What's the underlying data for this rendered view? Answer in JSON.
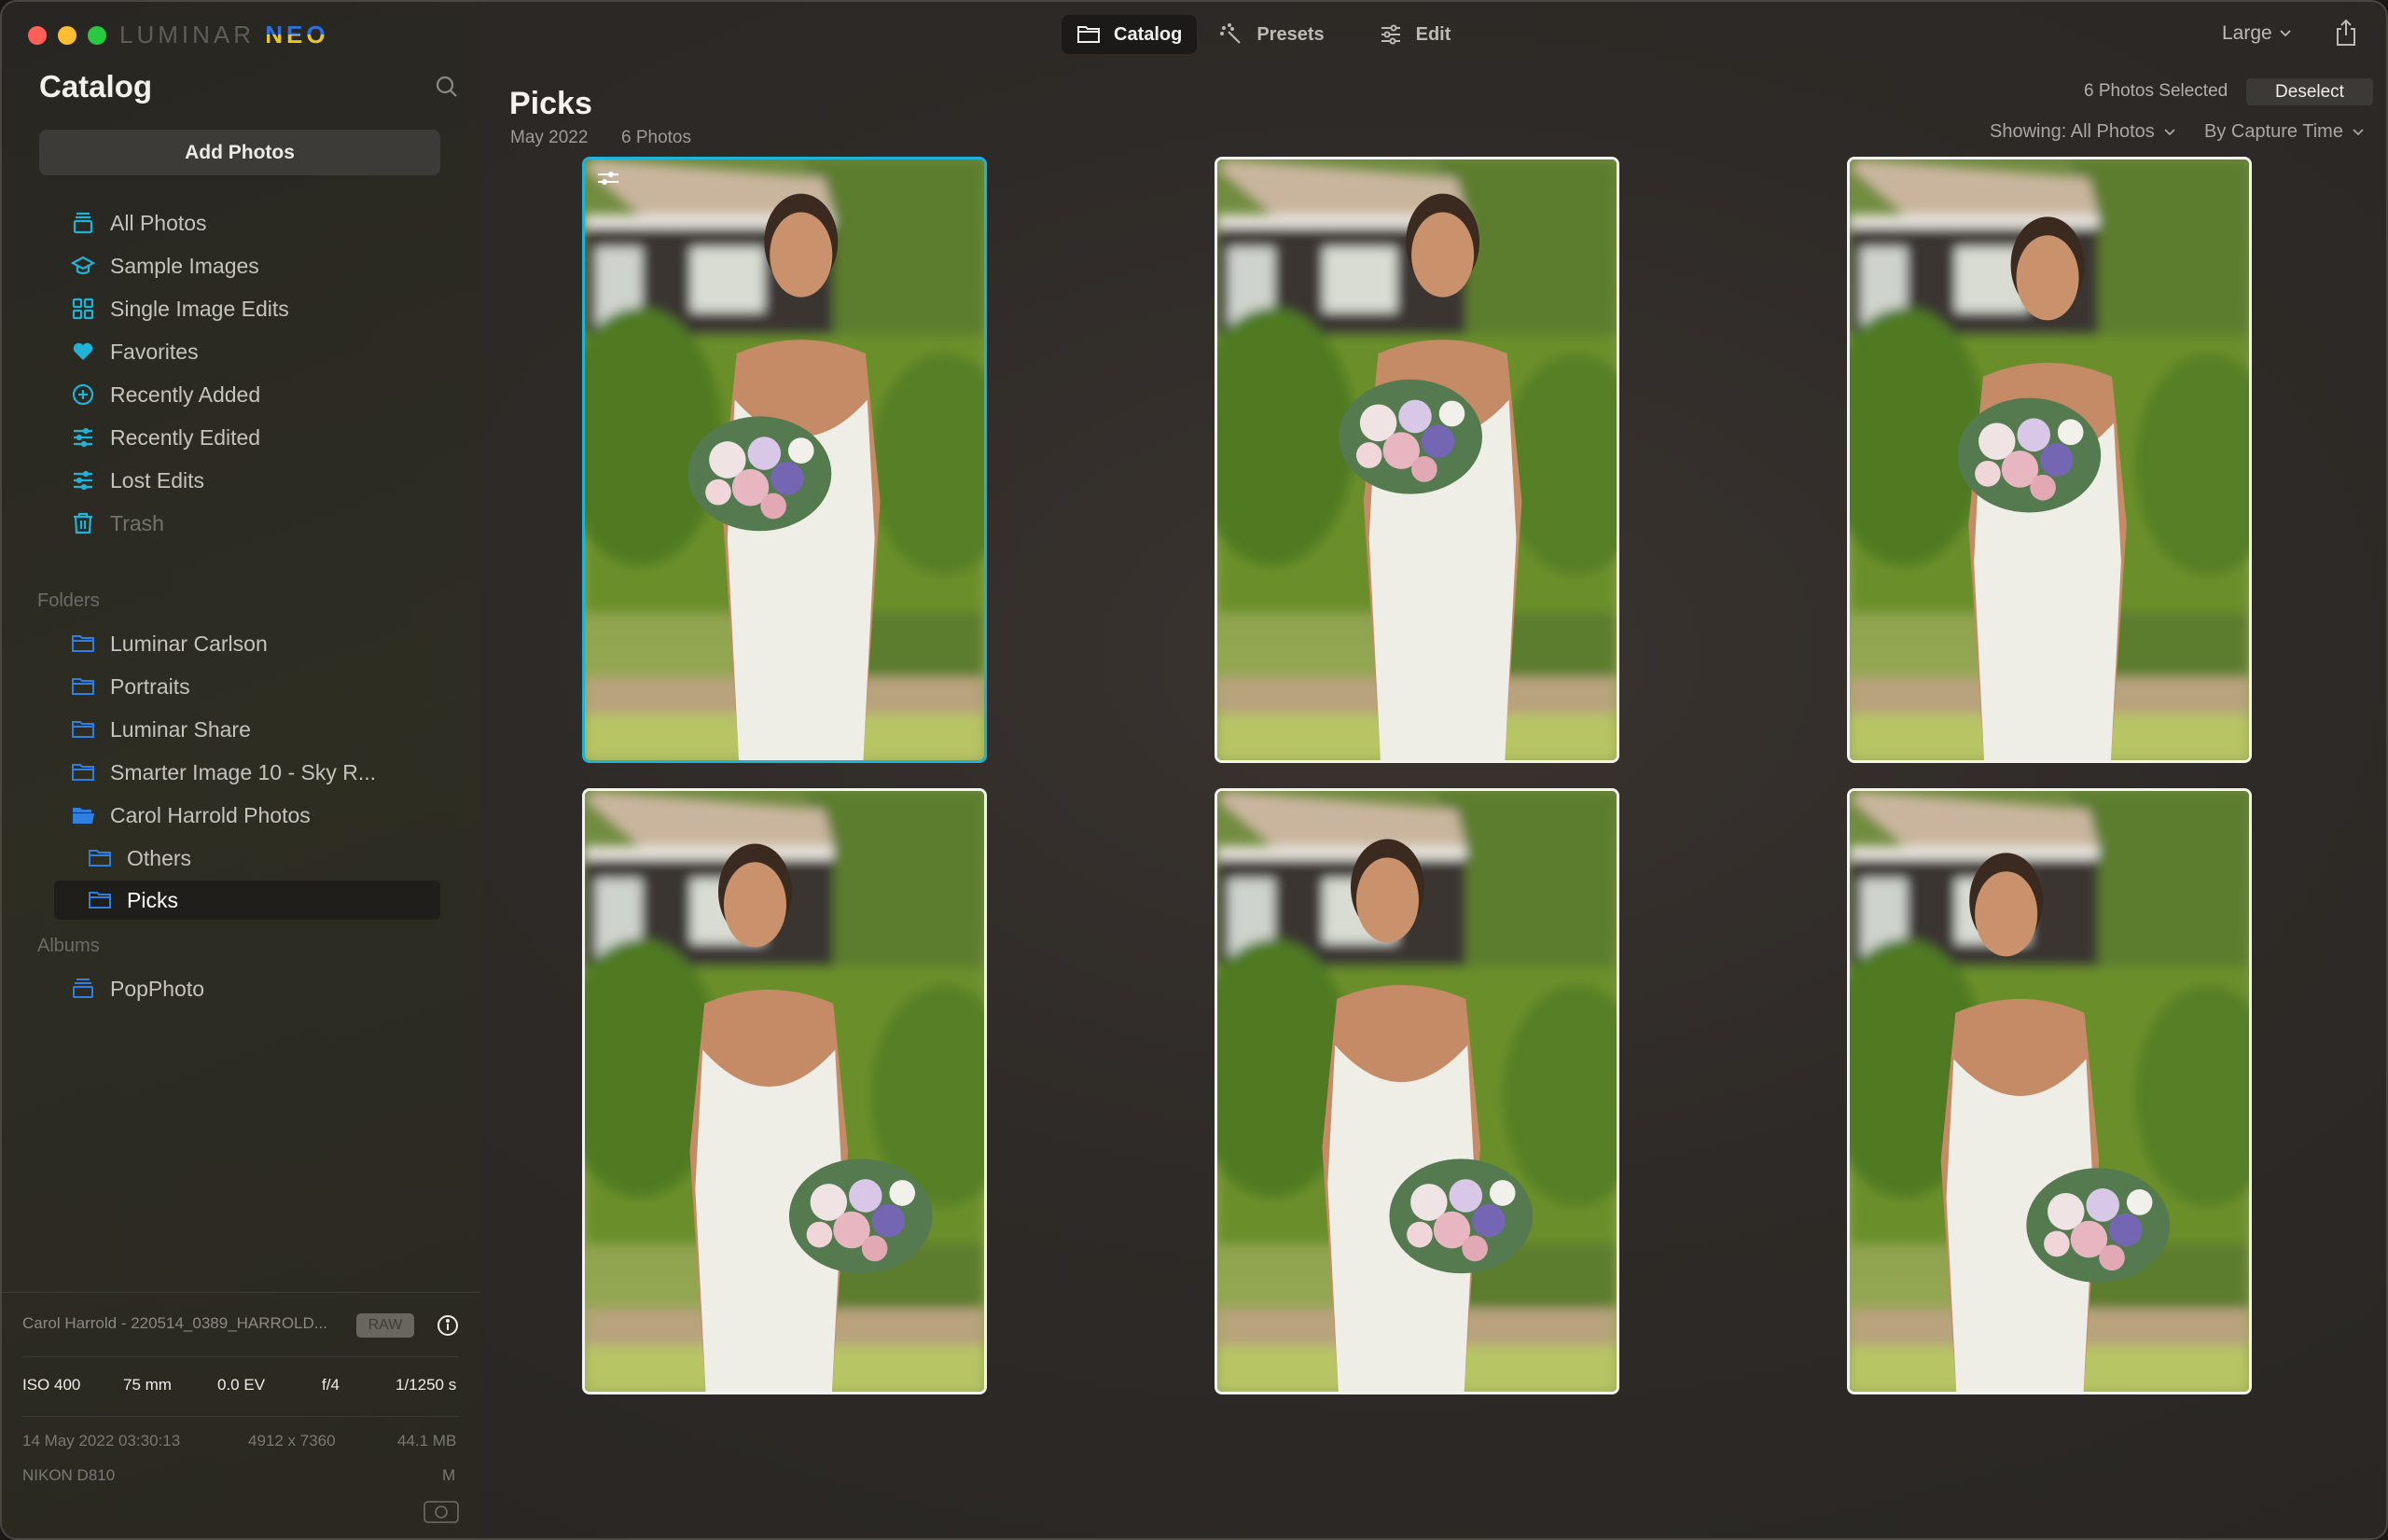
{
  "app": {
    "logo_part1": "LUMINAR",
    "logo_part2": "NEO",
    "accent_color": "#1fb3d8"
  },
  "modes": [
    {
      "label": "Catalog",
      "icon": "folder-icon",
      "active": true
    },
    {
      "label": "Presets",
      "icon": "magic-wand-icon",
      "active": false
    },
    {
      "label": "Edit",
      "icon": "sliders-icon",
      "active": false
    }
  ],
  "toolbar": {
    "size_label": "Large",
    "share_icon": "share-icon"
  },
  "sidebar": {
    "title": "Catalog",
    "add_photos_label": "Add Photos",
    "library": [
      {
        "label": "All Photos",
        "icon": "stack-icon"
      },
      {
        "label": "Sample Images",
        "icon": "graduation-cap-icon"
      },
      {
        "label": "Single Image Edits",
        "icon": "grid-icon"
      },
      {
        "label": "Favorites",
        "icon": "heart-icon"
      },
      {
        "label": "Recently Added",
        "icon": "plus-circle-icon"
      },
      {
        "label": "Recently Edited",
        "icon": "sliders-icon"
      },
      {
        "label": "Lost Edits",
        "icon": "sliders-icon"
      },
      {
        "label": "Trash",
        "icon": "trash-icon"
      }
    ],
    "folders_label": "Folders",
    "folders": [
      {
        "label": "Luminar Carlson"
      },
      {
        "label": "Portraits"
      },
      {
        "label": "Luminar Share"
      },
      {
        "label": "Smarter Image 10 - Sky R..."
      },
      {
        "label": "Carol Harrold Photos",
        "open": true
      },
      {
        "label": "Others",
        "child": true
      },
      {
        "label": "Picks",
        "child": true,
        "selected": true
      }
    ],
    "albums_label": "Albums",
    "albums": [
      {
        "label": "PopPhoto"
      }
    ]
  },
  "info": {
    "filename": "Carol Harrold - 220514_0389_HARROLD...",
    "format_badge": "RAW",
    "iso": "ISO 400",
    "focal": "75 mm",
    "ev": "0.0 EV",
    "aperture": "f/4",
    "shutter": "1/1250 s",
    "date": "14 May 2022 03:30:13",
    "dimensions": "4912 x 7360",
    "size": "44.1 MB",
    "camera": "NIKON D810",
    "mode": "M"
  },
  "main": {
    "title": "Picks",
    "date": "May 2022",
    "count": "6 Photos",
    "selected_count": "6 Photos Selected",
    "deselect_label": "Deselect",
    "showing_label": "Showing: All Photos",
    "sort_label": "By Capture Time",
    "photos": [
      {
        "alt": "Bride laughing holding bouquet",
        "selected": true,
        "edited": true
      },
      {
        "alt": "Bride smiling holding bouquet",
        "selected": false,
        "edited": false
      },
      {
        "alt": "Bride smiling, head tilted",
        "selected": false,
        "edited": false
      },
      {
        "alt": "Bride turned, bouquet at hip",
        "selected": false,
        "edited": false
      },
      {
        "alt": "Bride smiling, bouquet at hip",
        "selected": false,
        "edited": false
      },
      {
        "alt": "Bride looking aside, bouquet at hip",
        "selected": false,
        "edited": false
      }
    ]
  }
}
